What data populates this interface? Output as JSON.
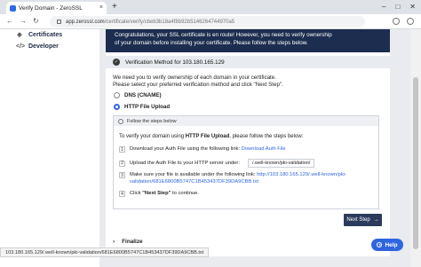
{
  "browser": {
    "tab_title": "Verify Domain - ZeroSSL",
    "tab_close": "×",
    "new_tab": "+",
    "url_host": "app.zerossl.com",
    "url_path": "/certificate/verify/cbeb3b18a4f8b92b5146264744970a5",
    "window_minimize": "–",
    "window_maximize": "□",
    "window_close": "✕"
  },
  "sidebar": {
    "items": [
      {
        "label": "Certificates",
        "icon": "shield-icon"
      },
      {
        "label": "Developer",
        "icon": "code-icon"
      }
    ]
  },
  "banner": {
    "line1": "Congratulations, your SSL certificate is en route! However, you need to verify ownership",
    "line2": "of your domain before installing your certificate. Please follow the steps below."
  },
  "verification": {
    "title": "Verification Method for 103.180.165.129",
    "desc1": "We need you to verify ownership of each domain in your certificate.",
    "desc2": "Please select your preferred verification method and click \"Next Step\".",
    "options": [
      {
        "label": "DNS (CNAME)",
        "selected": false
      },
      {
        "label": "HTTP File Upload",
        "selected": true
      }
    ]
  },
  "steps": {
    "header": "Follow the steps below",
    "intro_pre": "To verify your domain using ",
    "intro_method": "HTTP File Upload",
    "intro_post": ", please follow the steps below:",
    "s1_num": "1",
    "s1_text": "Download your Auth File using the following link: ",
    "s1_link": "Download Auth File",
    "s2_num": "2",
    "s2_text": "Upload the Auth File to your HTTP server under:",
    "s2_path": "/.well-known/pki-validation/",
    "s3_num": "3",
    "s3_text": "Make sure your file is available under the following link: ",
    "s3_link1": "http://103.180.165.129/.well-known/pki-",
    "s3_link2": "validation/681E6800B5747C1B453437DF39DA9CBB.txt",
    "s4_num": "4",
    "s4_pre": "Click ",
    "s4_bold": "\"Next Step\"",
    "s4_post": " to continue."
  },
  "next_button": {
    "label": "Next Step",
    "icon": "arrow-right-icon"
  },
  "finalize": {
    "label": "Finalize",
    "icon": "chevron-right-icon"
  },
  "status_url": "103.180.165.129/.well-known/pki-validation/681E6800B5747C1B453437DF39DA9CBB.txt",
  "help": {
    "label": "Help"
  }
}
